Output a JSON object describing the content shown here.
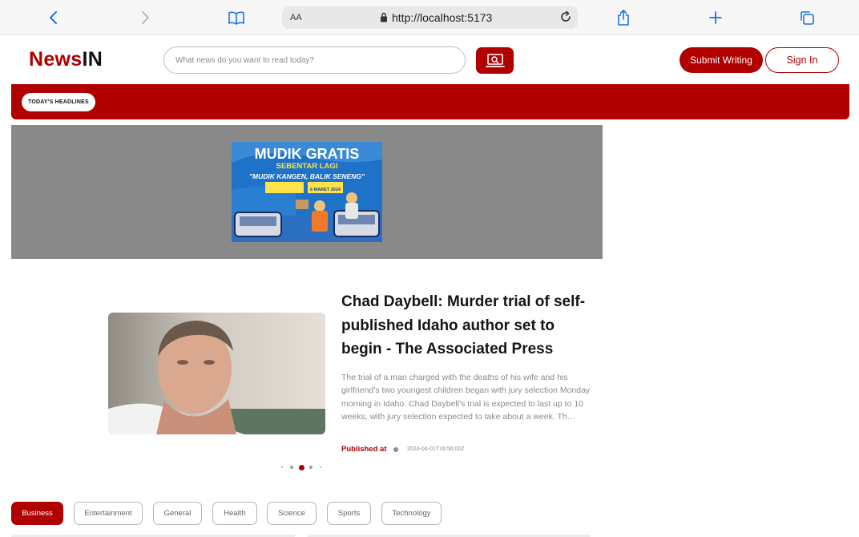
{
  "browser": {
    "text_size_label": "AA",
    "url": "http://localhost:5173"
  },
  "site": {
    "logo_part1": "News",
    "logo_part2": "IN",
    "search_placeholder": "What news do you want to read today?",
    "submit_label": "Submit Writing",
    "signin_label": "Sign In",
    "headlines_label": "TODAY'S HEADLINES",
    "brand_color": "#b00000"
  },
  "ad": {
    "line1": "MUDIK GRATIS",
    "line2": "SEBENTAR LAGI",
    "line3": "\"MUDIK KANGEN, BALIK SENENG\"",
    "date_label": "6 MARET 2024"
  },
  "featured": {
    "title": "Chad Daybell: Murder trial of self-published Idaho author set to begin - The Associated Press",
    "description": "The trial of a man charged with the deaths of his wife and his girlfriend's two youngest children began with jury selection Monday morning in Idaho. Chad Daybell's trial is expected to last up to 10 weeks, with jury selection expected to take about a week. Th…",
    "published_label": "Published at",
    "published_date": "2024-04-01T16:56:00Z"
  },
  "carousel": {
    "count": 5,
    "active_index": 2
  },
  "categories": [
    "Business",
    "Entertainment",
    "General",
    "Health",
    "Science",
    "Sports",
    "Technology"
  ],
  "active_category": "Business"
}
